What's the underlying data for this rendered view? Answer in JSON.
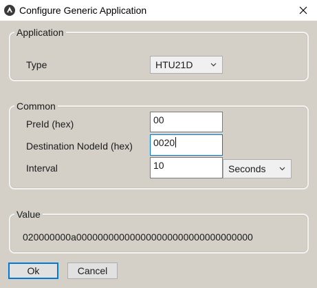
{
  "window": {
    "title": "Configure Generic Application",
    "icon": "app-logo-icon",
    "close_icon": "close-icon"
  },
  "application": {
    "legend": "Application",
    "type_label": "Type",
    "type_value": "HTU21D"
  },
  "common": {
    "legend": "Common",
    "preid_label": "PreId (hex)",
    "preid_value": "00",
    "dest_label": "Destination NodeId (hex)",
    "dest_value": "0020",
    "interval_label": "Interval",
    "interval_value": "10",
    "interval_unit": "Seconds"
  },
  "value": {
    "legend": "Value",
    "text": "020000000a000000000000000000000000000000000"
  },
  "buttons": {
    "ok": "Ok",
    "cancel": "Cancel"
  },
  "colors": {
    "dialog_bg": "#d4d0c8",
    "focus_accent": "#0078d7"
  }
}
